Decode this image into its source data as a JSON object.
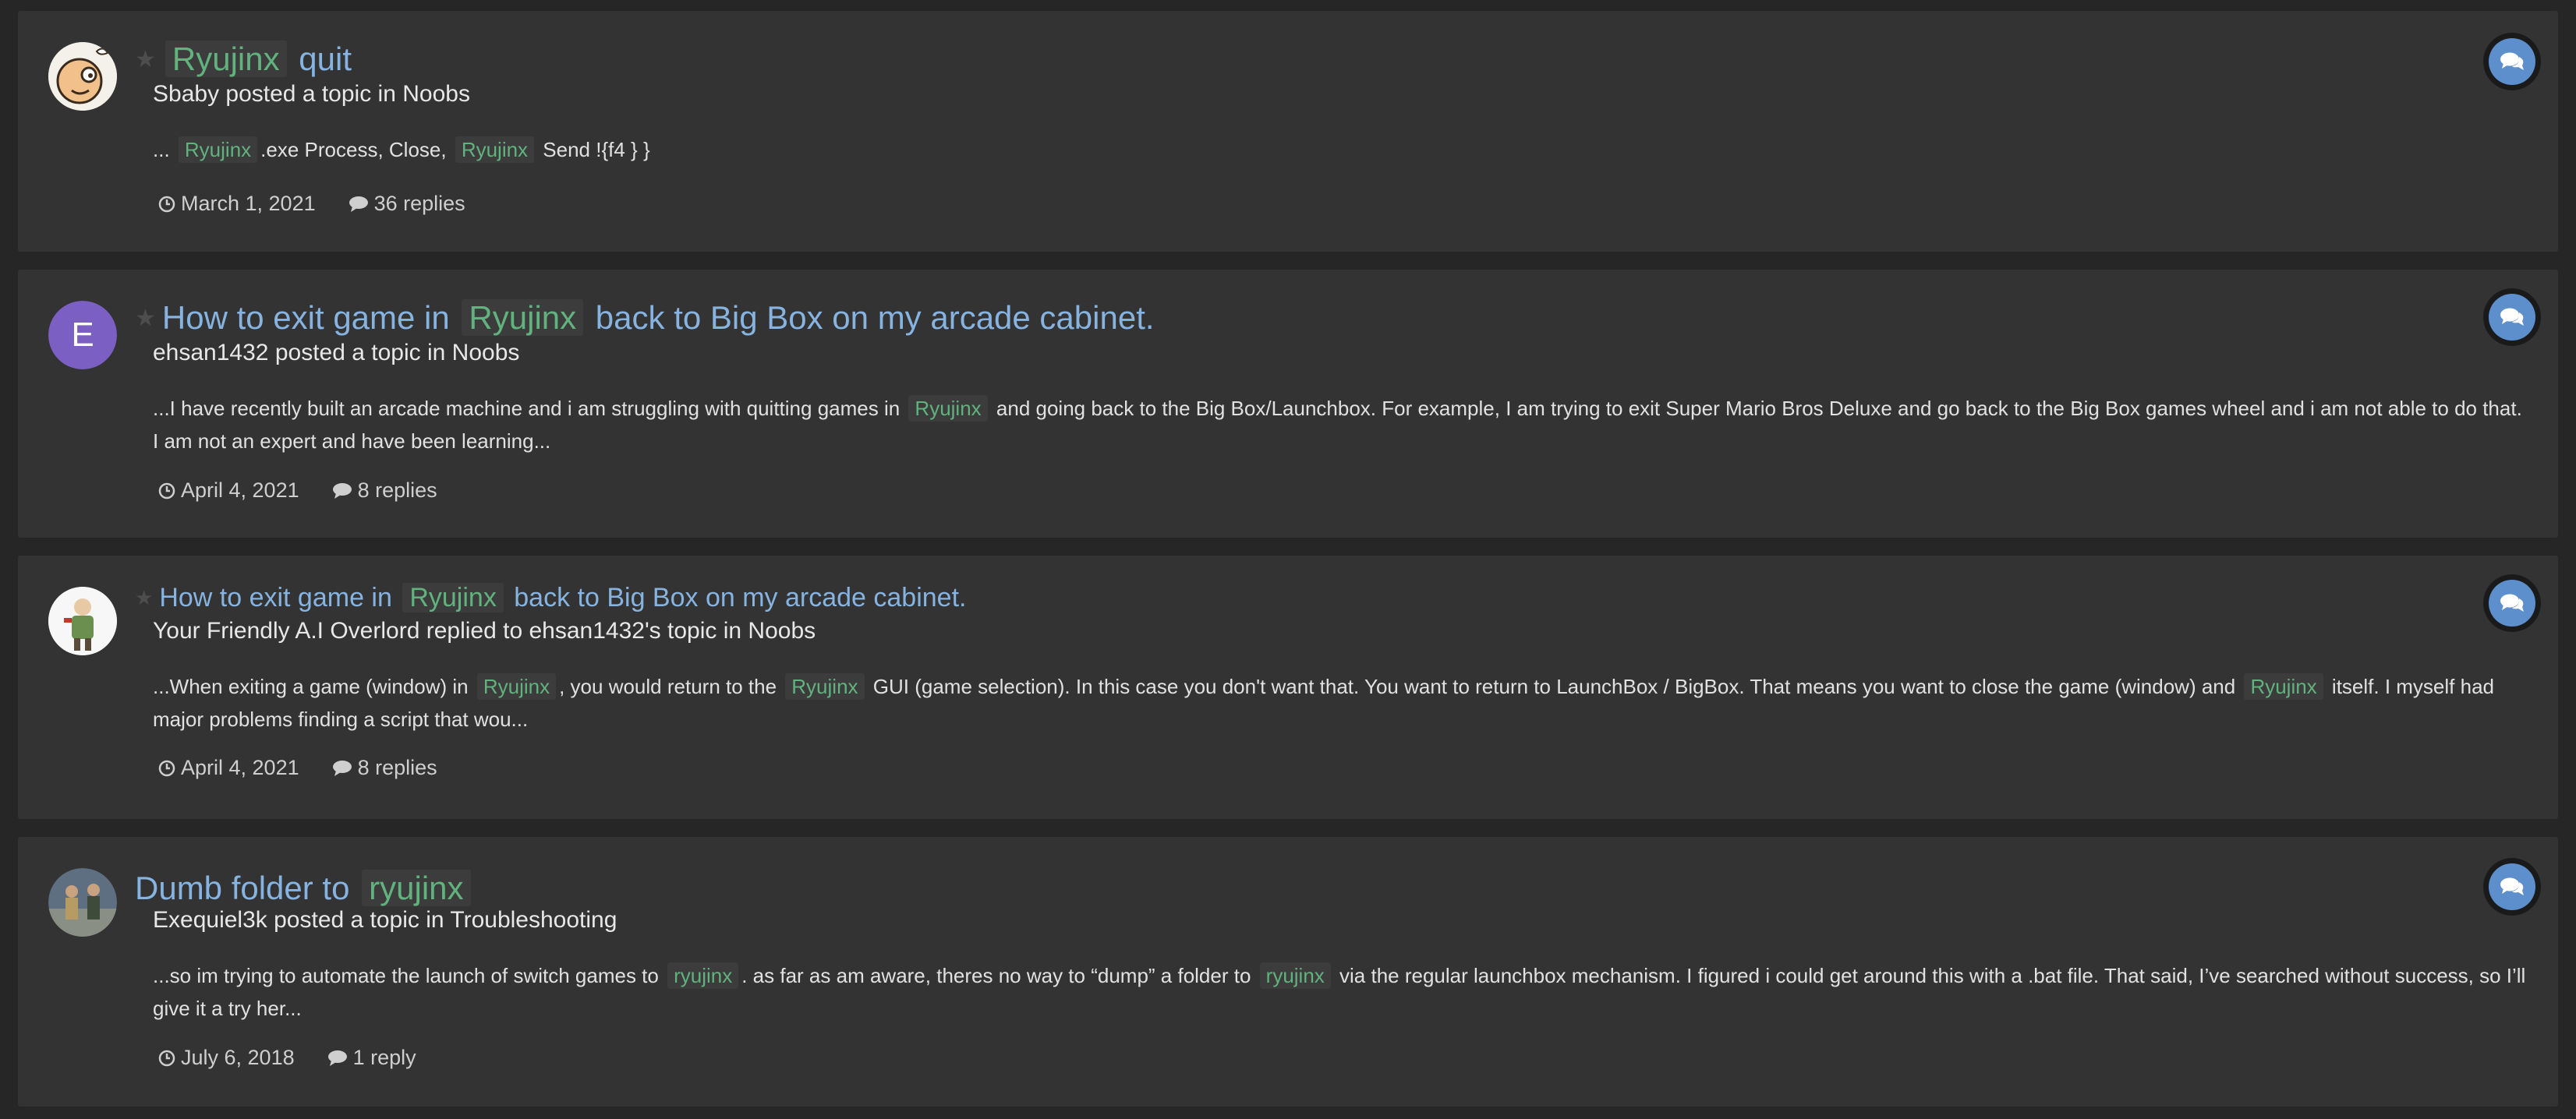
{
  "results": [
    {
      "title_parts": [
        "",
        "Ryujinx",
        " quit"
      ],
      "author": "Sbaby",
      "action": "posted a topic in",
      "forum": "Noobs",
      "snippet": [
        "... ",
        "Ryujinx",
        ".exe Process, Close, ",
        "Ryujinx",
        " Send !{f4 } }"
      ],
      "date": "March 1, 2021",
      "replies": "36 replies",
      "avatar": "cartoon-face-avatar",
      "type_icon": "comments-icon"
    },
    {
      "title_parts": [
        "How to exit game in ",
        "Ryujinx",
        " back to Big Box on my arcade cabinet."
      ],
      "author": "ehsan1432",
      "action": "posted a topic in",
      "forum": "Noobs",
      "snippet": [
        "...I have recently built an arcade machine and i am struggling with quitting games in ",
        "Ryujinx",
        " and going back to the Big Box/Launchbox. For example, I am trying to exit Super Mario Bros Deluxe and go back to the Big Box games wheel and i am not able to do that. I am not an expert and have been learning..."
      ],
      "date": "April 4, 2021",
      "replies": "8 replies",
      "avatar": "letter-avatar",
      "avatar_letter": "E",
      "avatar_color": "#7b5fc2",
      "type_icon": "comments-icon"
    },
    {
      "title_parts": [
        "How to exit game in ",
        "Ryujinx",
        " back to Big Box on my arcade cabinet."
      ],
      "author": "Your Friendly A.I Overlord",
      "action": "replied to ehsan1432's topic in",
      "forum": "Noobs",
      "snippet": [
        "...When exiting a game (window) in ",
        "Ryujinx",
        ", you would return to the ",
        "Ryujinx",
        " GUI (game selection). In this case you don't want that. You want to return to LaunchBox / BigBox. That means you want to close the game (window) and ",
        "Ryujinx",
        " itself. I myself had major problems finding a script that wou..."
      ],
      "date": "April 4, 2021",
      "replies": "8 replies",
      "avatar": "figure-avatar",
      "type_icon": "comments-icon"
    },
    {
      "title_parts": [
        "Dumb folder to ",
        "ryujinx",
        ""
      ],
      "author": "Exequiel3k",
      "action": "posted a topic in",
      "forum": "Troubleshooting",
      "snippet": [
        "...so im trying to automate the launch of switch games to ",
        "ryujinx",
        ". as far as am aware, theres no way to “dump” a folder to ",
        "ryujinx",
        " via the regular launchbox mechanism. I figured i could get around this with a .bat file. That said, I’ve searched without success, so I’ll give it a try her..."
      ],
      "date": "July 6, 2018",
      "replies": "1 reply",
      "avatar": "photo-avatar",
      "type_icon": "comments-icon"
    }
  ],
  "colors": {
    "background": "#262626",
    "card": "#333333",
    "title_link": "#86b3e0",
    "highlight_text": "#62b27f",
    "type_icon": "#5c8fcc"
  }
}
